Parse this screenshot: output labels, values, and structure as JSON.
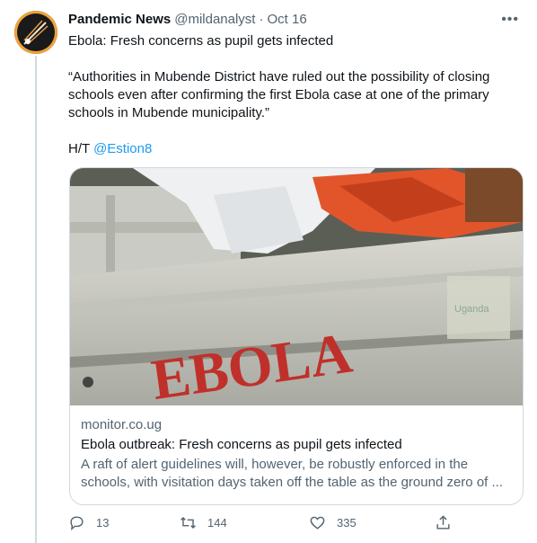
{
  "tweet": {
    "author_name": "Pandemic News",
    "handle": "@mildanalyst",
    "separator": "·",
    "timestamp": "Oct 16",
    "line1": "Ebola: Fresh concerns as pupil gets infected",
    "quote_l1": "“Authorities in Mubende District have ruled out the possibility of closing",
    "quote_l2": "schools even after confirming the first Ebola case at one of the primary",
    "quote_l3": "schools in Mubende municipality.”",
    "ht_prefix": "H/T ",
    "ht_mention": "@Estion8"
  },
  "card": {
    "image_text": "EBOLA",
    "image_side_text": "Uganda",
    "domain": "monitor.co.ug",
    "title": "Ebola outbreak: Fresh concerns as pupil gets infected",
    "desc_l1": "A raft of alert guidelines will, however, be robustly enforced in the",
    "desc_l2": "schools, with visitation days taken off the table as the ground zero of ..."
  },
  "actions": {
    "replies": "13",
    "retweets": "144",
    "likes": "335"
  },
  "icons": {
    "more": "more-dots-icon",
    "reply": "reply-icon",
    "retweet": "retweet-icon",
    "like": "heart-icon",
    "share": "share-icon"
  },
  "colors": {
    "link": "#1d9bf0",
    "secondary_text": "#536471",
    "avatar_ring": "#f0a23a"
  }
}
